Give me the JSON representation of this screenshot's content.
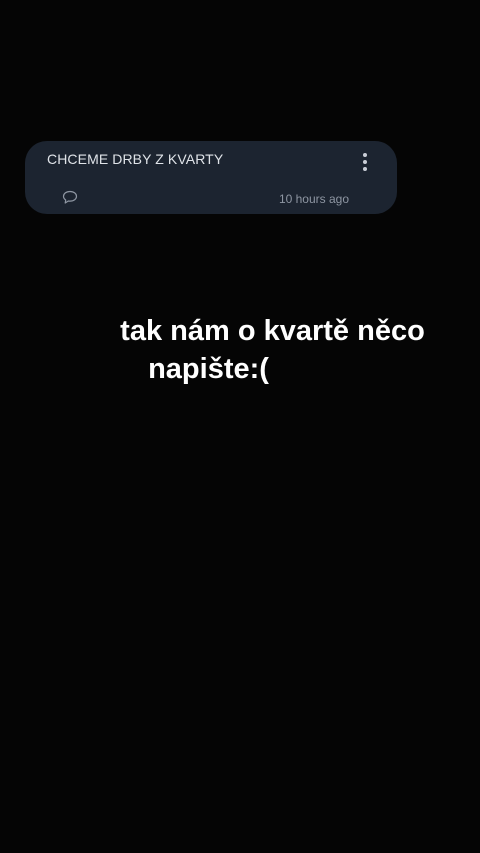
{
  "note_card": {
    "title": "CHCEME DRBY Z KVARTY",
    "timestamp": "10 hours ago",
    "comment_icon": "comment-bubble-icon",
    "menu_icon": "more-vertical-icon"
  },
  "caption": {
    "line1": "tak nám o kvartě něco",
    "line2": "napište:("
  },
  "colors": {
    "background": "#050505",
    "card": "#1c2430",
    "title_text": "#dfe3e8",
    "meta_text": "#8e96a2",
    "caption_text": "#ffffff"
  }
}
